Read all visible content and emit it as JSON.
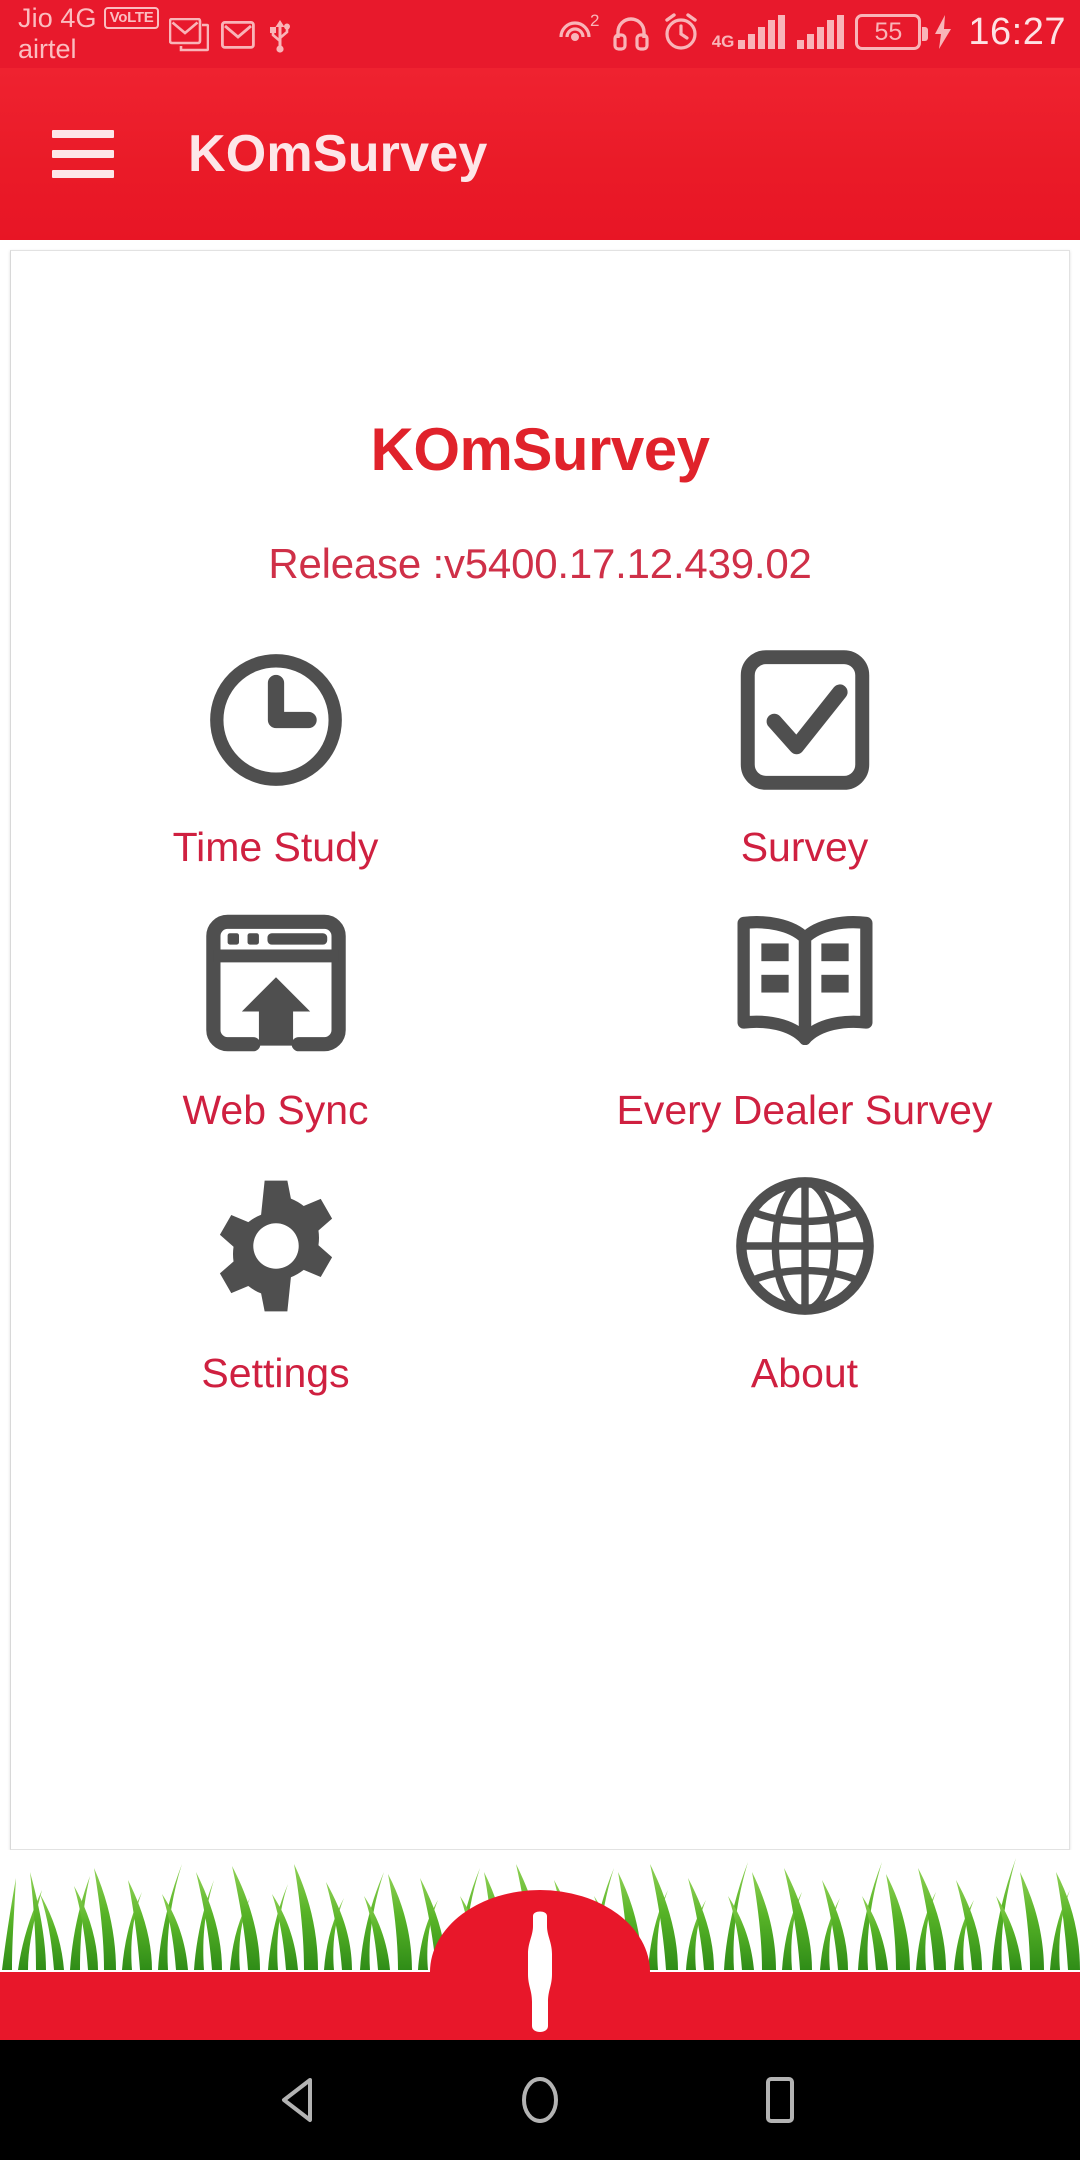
{
  "status_bar": {
    "carrier_primary": "Jio 4G",
    "volte_badge": "VoLTE",
    "carrier_secondary": "airtel",
    "gmail_icon_1": "gmail-icon",
    "gmail_icon_2": "gmail-icon",
    "usb_icon": "usb-icon",
    "hotspot_icon": "hotspot-icon",
    "hotspot_count": "2",
    "headset_icon": "headset-icon",
    "alarm_icon": "alarm-icon",
    "network_type": "4G",
    "battery_level": "55",
    "charging_icon": "charging-bolt-icon",
    "time": "16:27"
  },
  "app_bar": {
    "menu_icon": "hamburger-menu-icon",
    "title": "KOmSurvey"
  },
  "content": {
    "logo_text": "KOmSurvey",
    "release_label": "Release :v5400.17.12.439.02",
    "tiles": [
      {
        "label": "Time Study",
        "icon": "clock-icon"
      },
      {
        "label": "Survey",
        "icon": "checkbox-checked-icon"
      },
      {
        "label": "Web Sync",
        "icon": "browser-upload-icon"
      },
      {
        "label": "Every Dealer Survey",
        "icon": "open-book-icon"
      },
      {
        "label": "Settings",
        "icon": "gear-icon"
      },
      {
        "label": "About",
        "icon": "globe-icon"
      }
    ]
  },
  "footer": {
    "grass_art": "grass-illustration",
    "bottle_art": "coca-cola-bottle-silhouette"
  },
  "nav_bar": {
    "back": "back-triangle-icon",
    "home": "home-circle-icon",
    "recents": "recents-square-icon"
  },
  "colors": {
    "status_bar_red": "#e8192c",
    "app_bar_red": "#ea1b28",
    "logo_red": "#e0222b",
    "label_red": "#cf2040",
    "release_red": "#cf3048",
    "icon_gray": "#4f4f4f",
    "footer_red": "#e8172a",
    "grass_green": "#4aa520",
    "nav_bar_black": "#000000"
  }
}
